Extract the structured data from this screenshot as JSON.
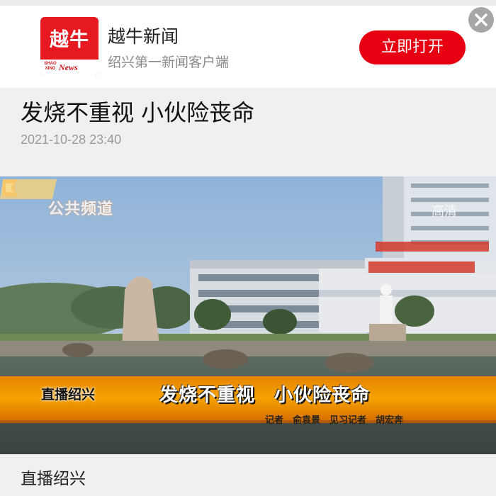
{
  "banner": {
    "logo_text": "越牛",
    "logo_shao": "SHAO XING",
    "logo_news": "News",
    "app_name": "越牛新闻",
    "app_subtitle": "绍兴第一新闻客户端",
    "open_button_label": "立即打开",
    "close_icon": "close-icon",
    "brand_color": "#e60012"
  },
  "article": {
    "title": "发烧不重视 小伙险丧命",
    "timestamp": "2021-10-28 23:40",
    "source": "直播绍兴"
  },
  "video": {
    "channel_label": "公共频道",
    "hd_label": "高清",
    "program_label": "直播绍兴",
    "caption": "发烧不重视　小伙险丧命",
    "credits": "记者　俞袁景　见习记者　胡宏奔"
  }
}
